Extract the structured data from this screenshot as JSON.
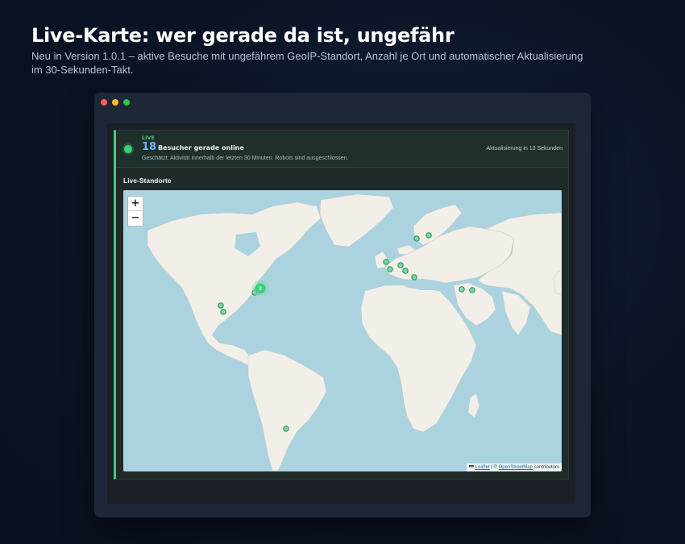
{
  "page": {
    "headline": "Live-Karte: wer gerade da ist, ungefähr",
    "subline": "Neu in Version 1.0.1 – aktive Besuche mit ungefährem GeoIP-Standort, Anzahl je Ort und automatischer Aktualisierung im 30-Sekunden-Takt."
  },
  "live": {
    "label": "LIVE",
    "count": "18",
    "count_text": "Besucher gerade online",
    "hint": "Geschätzt: Aktivität innerhalb der letzten 30 Minuten. Robots sind ausgeschlossen.",
    "refresh": "Aktualisierung in 13 Sekunden"
  },
  "map": {
    "section_title": "Live-Standorte",
    "zoom_in": "+",
    "zoom_out": "−",
    "attribution_leaflet": "Leaflet",
    "attribution_sep": "| ©",
    "attribution_osm": "OpenStreetMap",
    "attribution_suffix": "contributors",
    "cluster_count": "2",
    "colors": {
      "water": "#aad3df",
      "land": "#f2efe9",
      "marker_fill": "#7fd6a3",
      "marker_stroke": "#2f9a5e",
      "accent": "#3ecf7e"
    }
  }
}
